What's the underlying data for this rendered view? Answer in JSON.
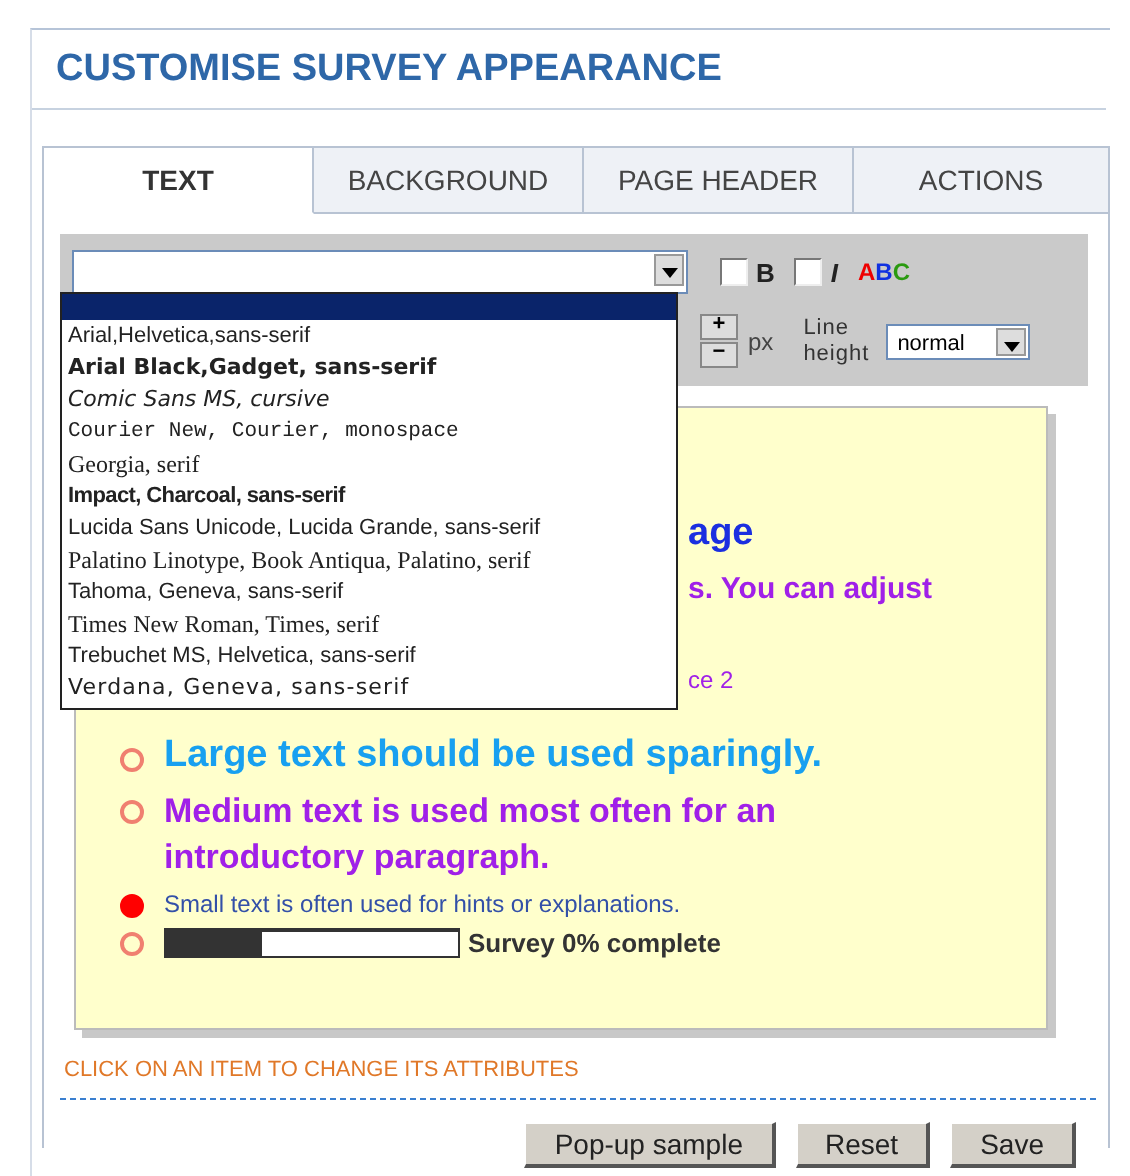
{
  "title": "CUSTOMISE SURVEY APPEARANCE",
  "tabs": [
    {
      "label": "TEXT",
      "selected": true
    },
    {
      "label": "BACKGROUND",
      "selected": false
    },
    {
      "label": "PAGE HEADER",
      "selected": false
    },
    {
      "label": "ACTIONS",
      "selected": false
    }
  ],
  "toolbar": {
    "bold_label": "B",
    "bold_checked": false,
    "italic_label": "I",
    "italic_checked": false,
    "color_label": "ABC",
    "plus_label": "+",
    "minus_label": "−",
    "px_label": "px",
    "line_height_label": "Line height",
    "line_height_value": "normal"
  },
  "font_dropdown": {
    "blank_row_highlighted": true,
    "options": [
      {
        "label": "Arial,Helvetica,sans-serif",
        "kind": "sans"
      },
      {
        "label": "Arial Black,Gadget, sans-serif",
        "kind": "black"
      },
      {
        "label": "Comic Sans MS, cursive",
        "kind": "cursive"
      },
      {
        "label": "Courier New, Courier, monospace",
        "kind": "mono"
      },
      {
        "label": "Georgia, serif",
        "kind": "serif"
      },
      {
        "label": "Impact, Charcoal, sans-serif",
        "kind": "impact"
      },
      {
        "label": "Lucida Sans Unicode, Lucida Grande, sans-serif",
        "kind": "sans"
      },
      {
        "label": "Palatino Linotype, Book Antiqua, Palatino, serif",
        "kind": "serif"
      },
      {
        "label": "Tahoma, Geneva, sans-serif",
        "kind": "sans"
      },
      {
        "label": "Times New Roman, Times, serif",
        "kind": "serif"
      },
      {
        "label": "Trebuchet MS, Helvetica, sans-serif",
        "kind": "sans"
      },
      {
        "label": "Verdana, Geneva, sans-serif",
        "kind": "wide"
      }
    ]
  },
  "preview": {
    "heading_fragment": "age",
    "intro_fragment": "s. You can adjust",
    "small_fragment": "ce 2",
    "items": [
      {
        "text": "Large text should be used sparingly.",
        "kind": "large",
        "selected": false
      },
      {
        "text": "Medium text is used most often for an introductory paragraph.",
        "kind": "medium",
        "selected": false
      },
      {
        "text": "Small text is often used for hints or explanations.",
        "kind": "small",
        "selected": true
      },
      {
        "kind": "progress",
        "selected": false,
        "level": 0.33,
        "text": "Survey 0% complete"
      }
    ]
  },
  "hint": "CLICK ON AN ITEM TO CHANGE ITS ATTRIBUTES",
  "buttons": [
    "Pop-up sample",
    "Reset",
    "Save"
  ]
}
